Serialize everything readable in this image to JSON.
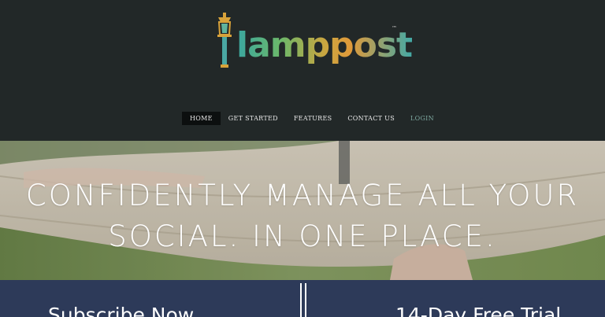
{
  "brand": {
    "name": "lamppost",
    "trademark": "™"
  },
  "nav": {
    "items": [
      {
        "label": "HOME"
      },
      {
        "label": "GET STARTED"
      },
      {
        "label": "FEATURES"
      },
      {
        "label": "CONTACT US"
      },
      {
        "label": "LOGIN"
      }
    ]
  },
  "hero": {
    "line1": "CONFIDENTLY MANAGE ALL YOUR",
    "line2": "SOCIAL. IN ONE PLACE."
  },
  "cta": {
    "subscribe": "Subscribe Now",
    "trial": "14-Day Free Trial"
  },
  "colors": {
    "header_bg": "#222828",
    "cta_bg": "#2d3a59",
    "nav_active_bg": "#0c0f0f",
    "login_color": "#7ea8a0"
  }
}
